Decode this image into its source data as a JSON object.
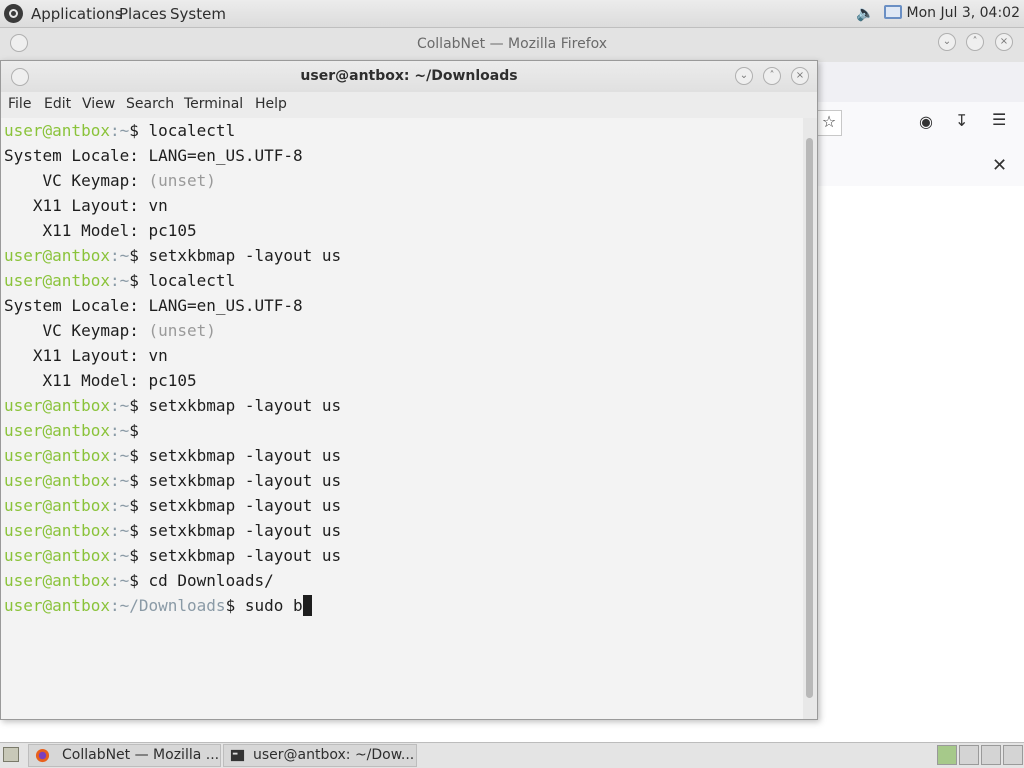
{
  "top_panel": {
    "menus": [
      "Applications",
      "Places",
      "System"
    ],
    "clock": "Mon Jul  3, 04:02",
    "volume_icon": "speaker-icon",
    "network_icon": "network-icon"
  },
  "firefox": {
    "title": "CollabNet — Mozilla Firefox"
  },
  "terminal": {
    "title": "user@antbox: ~/Downloads",
    "menu": [
      "File",
      "Edit",
      "View",
      "Search",
      "Terminal",
      "Help"
    ],
    "lines": [
      {
        "user": "user@antbox",
        "path": ":~",
        "sym": "$ ",
        "cmd": "localectl"
      },
      {
        "text": "System Locale: LANG=en_US.UTF-8"
      },
      {
        "text": "    VC Keymap: ",
        "dim": "(unset)"
      },
      {
        "text": "   X11 Layout: vn"
      },
      {
        "text": "    X11 Model: pc105"
      },
      {
        "user": "user@antbox",
        "path": ":~",
        "sym": "$ ",
        "cmd": "setxkbmap -layout us"
      },
      {
        "user": "user@antbox",
        "path": ":~",
        "sym": "$ ",
        "cmd": "localectl"
      },
      {
        "text": "System Locale: LANG=en_US.UTF-8"
      },
      {
        "text": "    VC Keymap: ",
        "dim": "(unset)"
      },
      {
        "text": "   X11 Layout: vn"
      },
      {
        "text": "    X11 Model: pc105"
      },
      {
        "user": "user@antbox",
        "path": ":~",
        "sym": "$ ",
        "cmd": "setxkbmap -layout us"
      },
      {
        "user": "user@antbox",
        "path": ":~",
        "sym": "$",
        "cmd": ""
      },
      {
        "user": "user@antbox",
        "path": ":~",
        "sym": "$ ",
        "cmd": "setxkbmap -layout us"
      },
      {
        "user": "user@antbox",
        "path": ":~",
        "sym": "$ ",
        "cmd": "setxkbmap -layout us"
      },
      {
        "user": "user@antbox",
        "path": ":~",
        "sym": "$ ",
        "cmd": "setxkbmap -layout us"
      },
      {
        "user": "user@antbox",
        "path": ":~",
        "sym": "$ ",
        "cmd": "setxkbmap -layout us"
      },
      {
        "user": "user@antbox",
        "path": ":~",
        "sym": "$ ",
        "cmd": "setxkbmap -layout us"
      },
      {
        "user": "user@antbox",
        "path": ":~",
        "sym": "$ ",
        "cmd": "cd Downloads/"
      },
      {
        "user": "user@antbox",
        "path": ":~/Downloads",
        "sym": "$ ",
        "cmd": "sudo b",
        "cursor": true
      }
    ]
  },
  "taskbar": {
    "tasks": [
      {
        "label": "CollabNet — Mozilla ...",
        "icon": "firefox-icon"
      },
      {
        "label": "user@antbox: ~/Dow...",
        "icon": "terminal-icon"
      }
    ]
  },
  "colors": {
    "prompt_user": "#8ac33a",
    "prompt_path": "#8a9aa6",
    "terminal_bg": "#f3f3f3"
  }
}
